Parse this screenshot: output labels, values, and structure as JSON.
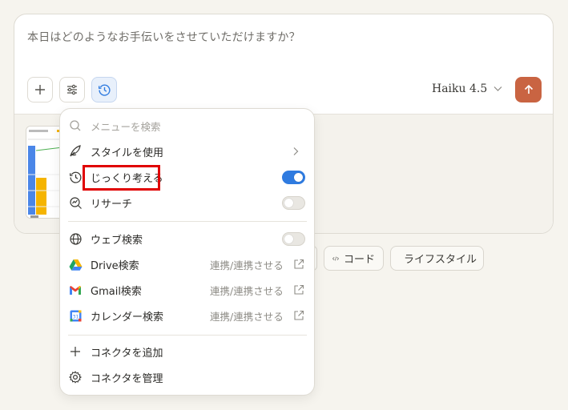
{
  "composer": {
    "placeholder": "本日はどのようなお手伝いをさせていただけますか？",
    "model_label": "Haiku 4.5"
  },
  "icons": {
    "add": "plus-icon",
    "options": "sliders-icon",
    "think": "clock-icon",
    "send": "arrow-up-icon",
    "model_chevron": "chevron-down-icon"
  },
  "menu": {
    "search_placeholder": "メニューを検索",
    "items": [
      {
        "label": "スタイルを使用",
        "icon": "feather-icon",
        "trailing": "chevron"
      },
      {
        "label": "じっくり考える",
        "icon": "clock-icon",
        "toggle": true
      },
      {
        "label": "リサーチ",
        "icon": "research-icon",
        "toggle": false
      },
      {
        "label": "ウェブ検索",
        "icon": "globe-icon",
        "toggle": false
      },
      {
        "label": "Drive検索",
        "icon": "drive-icon",
        "connect": "連携/連携させる"
      },
      {
        "label": "Gmail検索",
        "icon": "gmail-icon",
        "connect": "連携/連携させる"
      },
      {
        "label": "カレンダー検索",
        "icon": "calendar-icon",
        "connect": "連携/連携させる"
      },
      {
        "label": "コネクタを追加",
        "icon": "plus-icon"
      },
      {
        "label": "コネクタを管理",
        "icon": "gear-icon"
      }
    ]
  },
  "chips": [
    {
      "label": "コード",
      "icon": "code-icon"
    },
    {
      "label": "ライフスタイル",
      "icon": "coffee-icon"
    }
  ],
  "colors": {
    "accent": "#c96442",
    "toggle_on": "#2f7be0",
    "highlight": "#e00000"
  }
}
